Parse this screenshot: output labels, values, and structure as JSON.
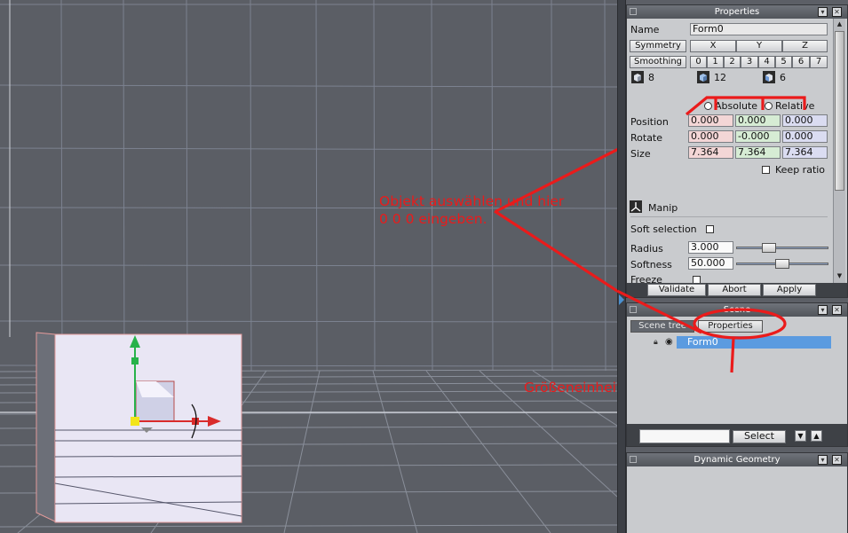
{
  "properties_panel": {
    "title": "Properties",
    "name_label": "Name",
    "name_value": "Form0",
    "symmetry_label": "Symmetry",
    "axis_buttons": [
      "X",
      "Y",
      "Z"
    ],
    "smoothing_label": "Smoothing",
    "smoothing_levels": [
      "0",
      "1",
      "2",
      "3",
      "4",
      "5",
      "6",
      "7"
    ],
    "counts": [
      "8",
      "12",
      "6"
    ],
    "absolute_label": "Absolute",
    "relative_label": "Relative",
    "position_label": "Position",
    "rotate_label": "Rotate",
    "size_label": "Size",
    "position": [
      "0.000",
      "0.000",
      "0.000"
    ],
    "rotate": [
      "0.000",
      "-0.000",
      "0.000"
    ],
    "size": [
      "7.364",
      "7.364",
      "7.364"
    ],
    "keep_ratio_label": "Keep ratio",
    "manip_label": "Manip",
    "soft_selection_label": "Soft selection",
    "radius_label": "Radius",
    "radius_value": "3.000",
    "radius_level": 0.33,
    "softness_label": "Softness",
    "softness_value": "50.000",
    "softness_level": 0.5,
    "freeze_label": "Freeze",
    "validate_label": "Validate",
    "abort_label": "Abort",
    "apply_label": "Apply"
  },
  "scene_panel": {
    "title": "Scene",
    "tabs": [
      "Scene tree",
      "Properties"
    ],
    "tree_item": "Form0",
    "select_label": "Select",
    "search_value": ""
  },
  "dynamic_geometry_panel": {
    "title": "Dynamic Geometry"
  },
  "annotations": {
    "note1": "Objekt auswählen und hier\n0 0 0 eingeben.",
    "note2": "Größeneinheit einstellen hier",
    "color": "#ea1b1b"
  },
  "colors": {
    "viewport_bg": "#5b5e65",
    "grid": "#7c8290",
    "axis_x": "#d92b2b",
    "axis_y": "#27b24a",
    "selection": "#5b9be0"
  }
}
